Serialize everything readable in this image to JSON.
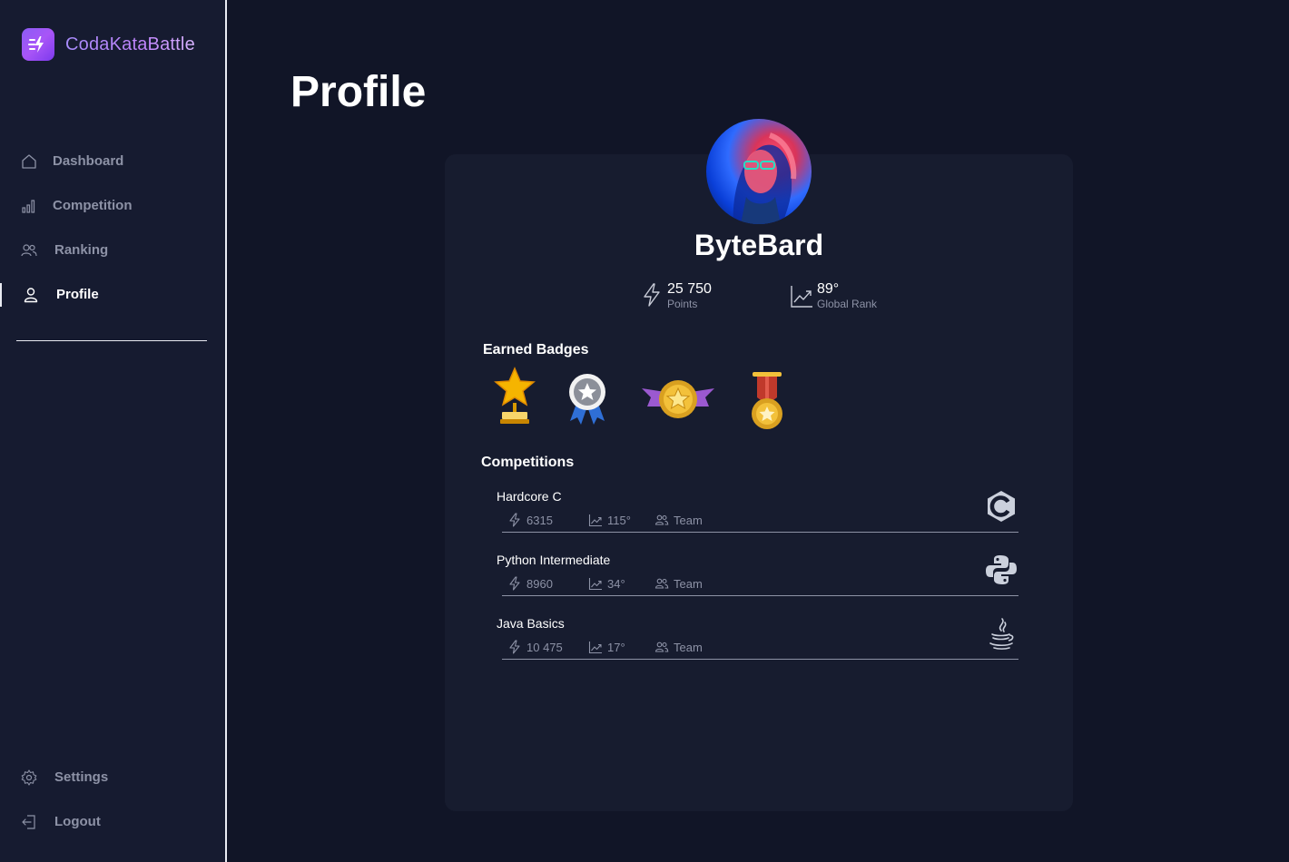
{
  "app": {
    "name": "CodaKataBattle",
    "brand_colors": [
      "#8b5cf6",
      "#c084fc"
    ]
  },
  "sidebar": {
    "items": [
      {
        "label": "Dashboard",
        "icon": "home-icon",
        "active": false
      },
      {
        "label": "Competition",
        "icon": "bar-chart-icon",
        "active": false
      },
      {
        "label": "Ranking",
        "icon": "users-icon",
        "active": false
      },
      {
        "label": "Profile",
        "icon": "user-icon",
        "active": true
      }
    ],
    "bottom_items": [
      {
        "label": "Settings",
        "icon": "gear-icon"
      },
      {
        "label": "Logout",
        "icon": "logout-icon"
      }
    ]
  },
  "page": {
    "title": "Profile"
  },
  "profile": {
    "username": "ByteBard",
    "points_value": "25 750",
    "points_label": "Points",
    "rank_value": "89°",
    "rank_label": "Global Rank"
  },
  "badges": {
    "title": "Earned Badges",
    "items": [
      "star-trophy-icon",
      "silver-star-ribbon-icon",
      "gold-winged-medal-icon",
      "gold-star-medal-icon"
    ]
  },
  "competitions": {
    "title": "Competitions",
    "rows": [
      {
        "name": "Hardcore C",
        "points": "6315",
        "rank": "115°",
        "mode": "Team",
        "language_icon": "c-language-icon"
      },
      {
        "name": "Python Intermediate",
        "points": "8960",
        "rank": "34°",
        "mode": "Team",
        "language_icon": "python-icon"
      },
      {
        "name": "Java Basics",
        "points": "10 475",
        "rank": "17°",
        "mode": "Team",
        "language_icon": "java-icon"
      }
    ]
  }
}
